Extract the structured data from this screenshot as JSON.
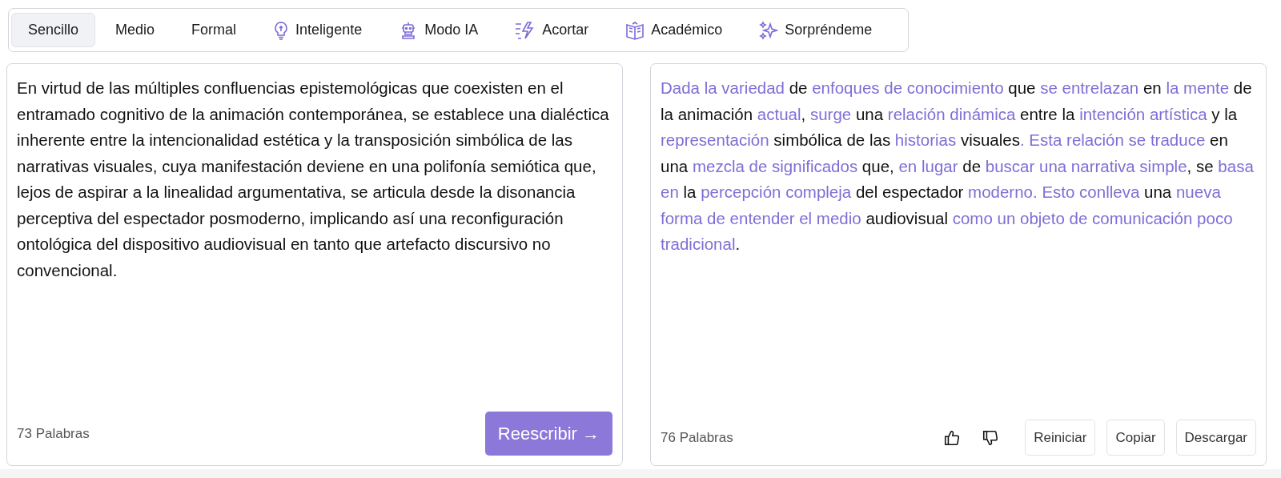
{
  "tabs": [
    {
      "label": "Sencillo",
      "kind": "plain",
      "selected": true
    },
    {
      "label": "Medio",
      "kind": "plain",
      "selected": false
    },
    {
      "label": "Formal",
      "kind": "plain",
      "selected": false
    },
    {
      "label": "Inteligente",
      "kind": "iconic",
      "selected": false
    },
    {
      "label": "Modo IA",
      "kind": "iconic",
      "selected": false
    },
    {
      "label": "Acortar",
      "kind": "iconic",
      "selected": false
    },
    {
      "label": "Académico",
      "kind": "iconic",
      "selected": false
    },
    {
      "label": "Sorpréndeme",
      "kind": "iconic",
      "selected": false
    }
  ],
  "input": {
    "text": "En virtud de las múltiples confluencias epistemológicas que coexisten en el entramado cognitivo de la animación contemporánea, se establece una dialéctica inherente entre la intencionalidad estética y la transposición simbólica de las narrativas visuales, cuya manifestación deviene en una polifonía semiótica que, lejos de aspirar a la linealidad argumentativa, se articula desde la disonancia perceptiva del espectador posmoderno, implicando así una reconfiguración ontológica del dispositivo audiovisual en tanto que artefacto discursivo no convencional.",
    "word_count": "73 Palabras",
    "button": "Reescribir →"
  },
  "output": {
    "segments": [
      {
        "text": "Dada la variedad",
        "changed": true
      },
      {
        "text": " de ",
        "changed": false
      },
      {
        "text": "enfoques de conocimiento",
        "changed": true
      },
      {
        "text": " que ",
        "changed": false
      },
      {
        "text": "se entrelazan",
        "changed": true
      },
      {
        "text": " en ",
        "changed": false
      },
      {
        "text": "la mente",
        "changed": true
      },
      {
        "text": " de la animación ",
        "changed": false
      },
      {
        "text": "actual",
        "changed": true
      },
      {
        "text": ", ",
        "changed": false
      },
      {
        "text": "surge",
        "changed": true
      },
      {
        "text": " una ",
        "changed": false
      },
      {
        "text": "relación dinámica",
        "changed": true
      },
      {
        "text": " entre la ",
        "changed": false
      },
      {
        "text": "intención artística",
        "changed": true
      },
      {
        "text": " y la ",
        "changed": false
      },
      {
        "text": "representación",
        "changed": true
      },
      {
        "text": " simbólica de las ",
        "changed": false
      },
      {
        "text": "historias",
        "changed": true
      },
      {
        "text": " visuales",
        "changed": false
      },
      {
        "text": ". Esta relación se traduce",
        "changed": true
      },
      {
        "text": " en una ",
        "changed": false
      },
      {
        "text": "mezcla de significados",
        "changed": true
      },
      {
        "text": " que, ",
        "changed": false
      },
      {
        "text": "en lugar",
        "changed": true
      },
      {
        "text": " de ",
        "changed": false
      },
      {
        "text": "buscar una narrativa simple",
        "changed": true
      },
      {
        "text": ", se ",
        "changed": false
      },
      {
        "text": "basa en",
        "changed": true
      },
      {
        "text": " la ",
        "changed": false
      },
      {
        "text": "percepción compleja",
        "changed": true
      },
      {
        "text": " del espectador ",
        "changed": false
      },
      {
        "text": "moderno. Esto conlleva",
        "changed": true
      },
      {
        "text": " una ",
        "changed": false
      },
      {
        "text": "nueva forma de entender el medio",
        "changed": true
      },
      {
        "text": " audiovisual ",
        "changed": false
      },
      {
        "text": "como un objeto de comunicación poco tradicional",
        "changed": true
      },
      {
        "text": ".",
        "changed": false
      }
    ],
    "word_count": "76 Palabras",
    "buttons": [
      "Reiniciar",
      "Copiar",
      "Descargar"
    ]
  }
}
